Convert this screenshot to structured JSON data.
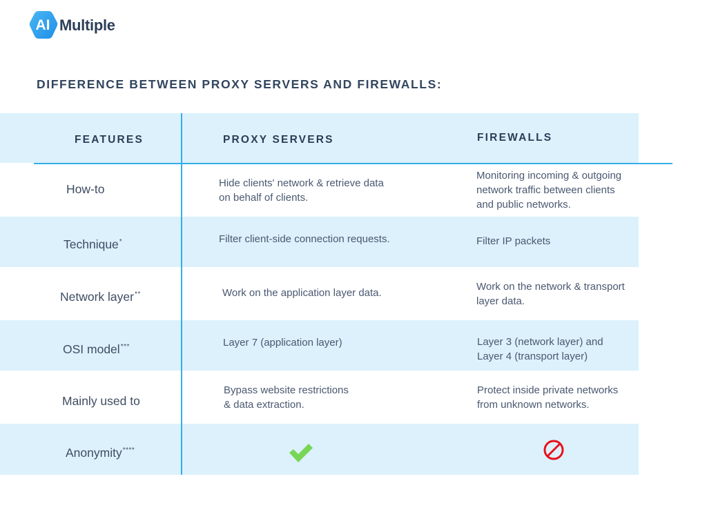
{
  "brand": {
    "logo_mark": "AI",
    "logo_text": "Multiple",
    "colors": {
      "hex_start": "#49b6f3",
      "hex_end": "#1f8fe8",
      "text": "#2d3e58"
    }
  },
  "title": "DIFFERENCE BETWEEN  PROXY SERVERS AND FIREWALLS:",
  "colors": {
    "accent_line": "#35aeea",
    "row_shade": "#dcf1fc",
    "check": "#78d655",
    "prohibited": "#e8121c"
  },
  "table": {
    "headers": [
      "FEATURES",
      "PROXY SERVERS",
      "FIREWALLS"
    ],
    "rows": [
      {
        "feature": "How-to",
        "marks": "",
        "proxy": [
          "Hide clients' network & retrieve data",
          "on  behalf of clients."
        ],
        "firewall": [
          "Monitoring incoming & outgoing",
          "network traffic between clients",
          "and public networks."
        ]
      },
      {
        "feature": "Technique",
        "marks": "*",
        "proxy": [
          "Filter client-side connection requests."
        ],
        "firewall": [
          "Filter IP packets"
        ]
      },
      {
        "feature": "Network layer",
        "marks": "**",
        "proxy": [
          "Work on the application layer data."
        ],
        "firewall": [
          "Work on the network & transport",
          "layer data."
        ]
      },
      {
        "feature": "OSI model",
        "marks": "***",
        "proxy": [
          "Layer 7 (application layer)"
        ],
        "firewall": [
          "Layer 3 (network layer) and",
          "Layer 4  (transport layer)"
        ]
      },
      {
        "feature": "Mainly used to",
        "marks": "",
        "proxy": [
          "Bypass website restrictions",
          "& data extraction."
        ],
        "firewall": [
          "Protect inside private networks",
          "from unknown networks."
        ]
      },
      {
        "feature": "Anonymity",
        "marks": "****",
        "proxy_icon": "check-icon",
        "firewall_icon": "prohibited-icon"
      }
    ]
  }
}
